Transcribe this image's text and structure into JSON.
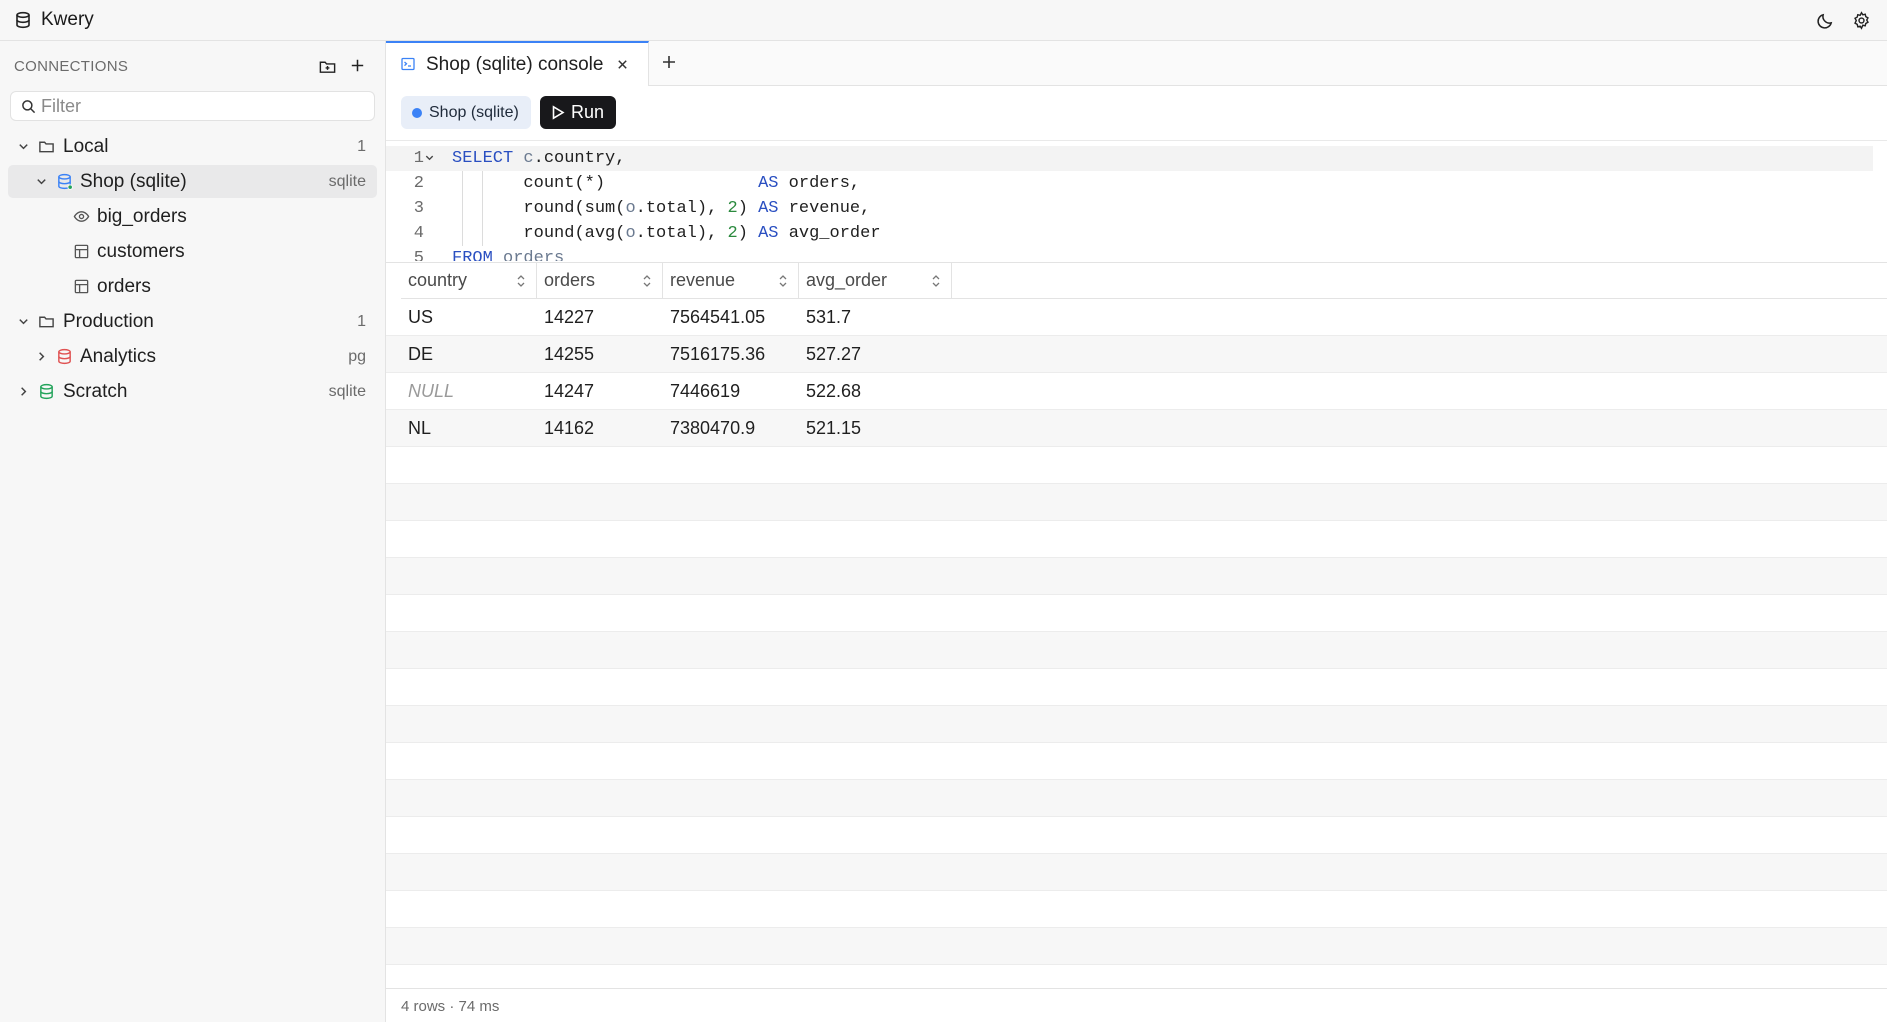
{
  "app": {
    "name": "Kwery"
  },
  "sidebar": {
    "header": "CONNECTIONS",
    "filter_placeholder": "Filter",
    "tree": {
      "local": {
        "label": "Local",
        "count": "1"
      },
      "shop": {
        "label": "Shop (sqlite)",
        "meta": "sqlite"
      },
      "big_orders": {
        "label": "big_orders"
      },
      "customers": {
        "label": "customers"
      },
      "orders": {
        "label": "orders"
      },
      "production": {
        "label": "Production",
        "count": "1"
      },
      "analytics": {
        "label": "Analytics",
        "meta": "pg"
      },
      "scratch": {
        "label": "Scratch",
        "meta": "sqlite"
      }
    }
  },
  "tabs": [
    {
      "label": "Shop (sqlite) console",
      "active": true
    }
  ],
  "toolbar": {
    "connection": "Shop (sqlite)",
    "run_label": "Run"
  },
  "editor": {
    "line_numbers": [
      "1",
      "2",
      "3",
      "4",
      "5"
    ]
  },
  "results": {
    "columns": [
      "country",
      "orders",
      "revenue",
      "avg_order"
    ],
    "rows": [
      [
        "US",
        "14227",
        "7564541.05",
        "531.7"
      ],
      [
        "DE",
        "14255",
        "7516175.36",
        "527.27"
      ],
      [
        "NULL",
        "14247",
        "7446619",
        "522.68"
      ],
      [
        "NL",
        "14162",
        "7380470.9",
        "521.15"
      ]
    ]
  },
  "status": {
    "text": "4 rows · 74 ms"
  },
  "colors": {
    "accent": "#3b82f6",
    "keyword": "#2a4fc1",
    "number": "#2b8a3e",
    "sqlite_db": "#22a35a",
    "pg_db": "#e05252",
    "run_button": "#18181b"
  }
}
